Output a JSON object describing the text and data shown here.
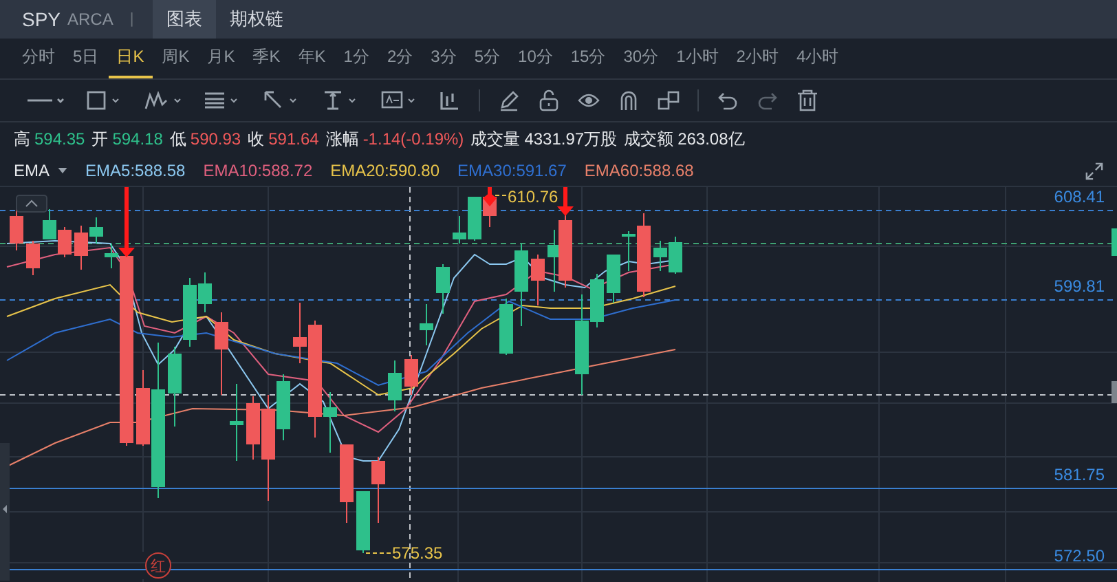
{
  "header": {
    "symbol": "SPY",
    "exchange": "ARCA",
    "separator": "|",
    "tabs": [
      {
        "label": "图表",
        "selected": true
      },
      {
        "label": "期权链",
        "selected": false
      }
    ]
  },
  "periods": [
    {
      "label": "分时",
      "selected": false
    },
    {
      "label": "5日",
      "selected": false
    },
    {
      "label": "日K",
      "selected": true
    },
    {
      "label": "周K",
      "selected": false
    },
    {
      "label": "月K",
      "selected": false
    },
    {
      "label": "季K",
      "selected": false
    },
    {
      "label": "年K",
      "selected": false
    },
    {
      "label": "1分",
      "selected": false
    },
    {
      "label": "2分",
      "selected": false
    },
    {
      "label": "3分",
      "selected": false
    },
    {
      "label": "5分",
      "selected": false
    },
    {
      "label": "10分",
      "selected": false
    },
    {
      "label": "15分",
      "selected": false
    },
    {
      "label": "30分",
      "selected": false
    },
    {
      "label": "1小时",
      "selected": false
    },
    {
      "label": "2小时",
      "selected": false
    },
    {
      "label": "4小时",
      "selected": false
    }
  ],
  "quote": [
    {
      "label": "高",
      "value": "594.35",
      "color": "#2ec08b"
    },
    {
      "label": "开",
      "value": "594.18",
      "color": "#2ec08b"
    },
    {
      "label": "低",
      "value": "590.93",
      "color": "#f0595a"
    },
    {
      "label": "收",
      "value": "591.64",
      "color": "#f0595a"
    },
    {
      "label": "涨幅",
      "value": "-1.14(-0.19%)",
      "color": "#f0595a"
    },
    {
      "label": "成交量",
      "value": "4331.97万股",
      "color": "#e6e8eb"
    },
    {
      "label": "成交额",
      "value": "263.08亿",
      "color": "#e6e8eb"
    }
  ],
  "indicator": {
    "name": "EMA",
    "lines": [
      {
        "label": "EMA5:588.58",
        "color": "#8cc8f0"
      },
      {
        "label": "EMA10:588.72",
        "color": "#e0607e"
      },
      {
        "label": "EMA20:590.80",
        "color": "#e8c44a"
      },
      {
        "label": "EMA30:591.67",
        "color": "#2f6fd0"
      },
      {
        "label": "EMA60:588.68",
        "color": "#e8806a"
      }
    ]
  },
  "chart": {
    "price_lines": [
      {
        "label": "608.41"
      },
      {
        "label": "599.81"
      },
      {
        "label": "581.75"
      },
      {
        "label": "572.50"
      }
    ],
    "high_label": "610.76",
    "low_label": "575.35",
    "badge": "红"
  }
}
